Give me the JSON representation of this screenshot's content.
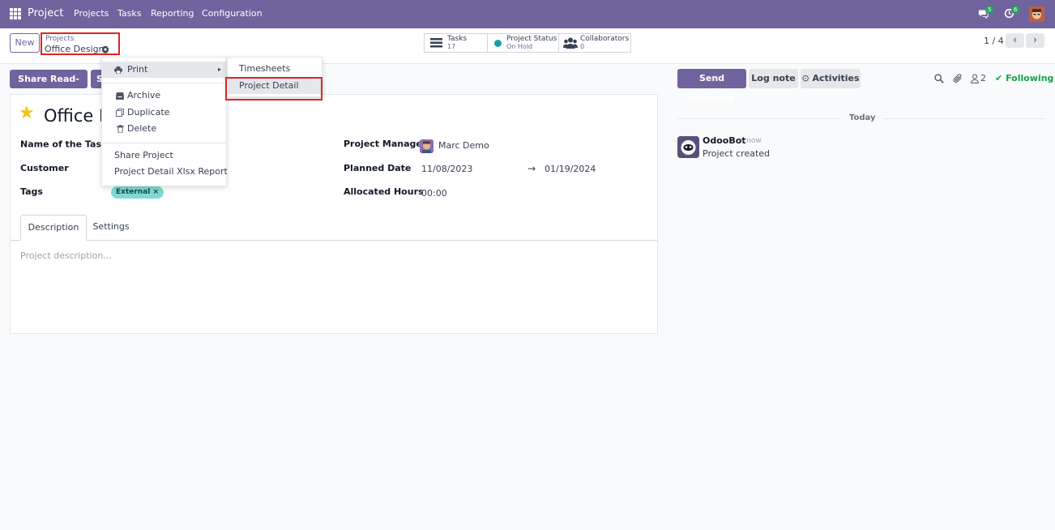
{
  "navbar": {
    "app_name": "Project",
    "menus": [
      "Projects",
      "Tasks",
      "Reporting",
      "Configuration"
    ],
    "messages_badge": "5",
    "activities_badge": "6",
    "bg_color": "#71639e"
  },
  "control": {
    "new_label": "New",
    "breadcrumb_parent": "Projects",
    "breadcrumb_current": "Office Design",
    "stats": [
      {
        "label": "Tasks",
        "value": "17"
      },
      {
        "label": "Project Status",
        "value": "On Hold"
      },
      {
        "label": "Collaborators",
        "value": "0"
      }
    ],
    "pager": "1 / 4"
  },
  "actions": {
    "share_readonly": "Share Read-only",
    "share_editable_partial": "S"
  },
  "form": {
    "title_partial": "Office D",
    "labels": {
      "tasks_name": "Name of the Tasks",
      "customer": "Customer",
      "tags": "Tags",
      "project_manager": "Project Manager",
      "planned_date": "Planned Date",
      "allocated_hours": "Allocated Hours"
    },
    "help_mark": "?",
    "project_manager": "Marc Demo",
    "planned_start": "11/08/2023",
    "planned_end": "01/19/2024",
    "allocated_hours": "00:00",
    "tag": "External ×",
    "tabs": [
      "Description",
      "Settings"
    ],
    "description_placeholder": "Project description..."
  },
  "gear_menu": {
    "print": "Print",
    "archive": "Archive",
    "duplicate": "Duplicate",
    "delete": "Delete",
    "share_project": "Share Project",
    "xlsx_report": "Project Detail Xlsx Report"
  },
  "print_submenu": {
    "timesheets": "Timesheets",
    "project_detail": "Project Detail"
  },
  "chatter": {
    "send_message": "Send message",
    "log_note": "Log note",
    "activities": "Activities",
    "followers_count": "2",
    "following": "Following",
    "today": "Today",
    "author": "OdooBot",
    "time": "- now",
    "body": "Project created"
  }
}
